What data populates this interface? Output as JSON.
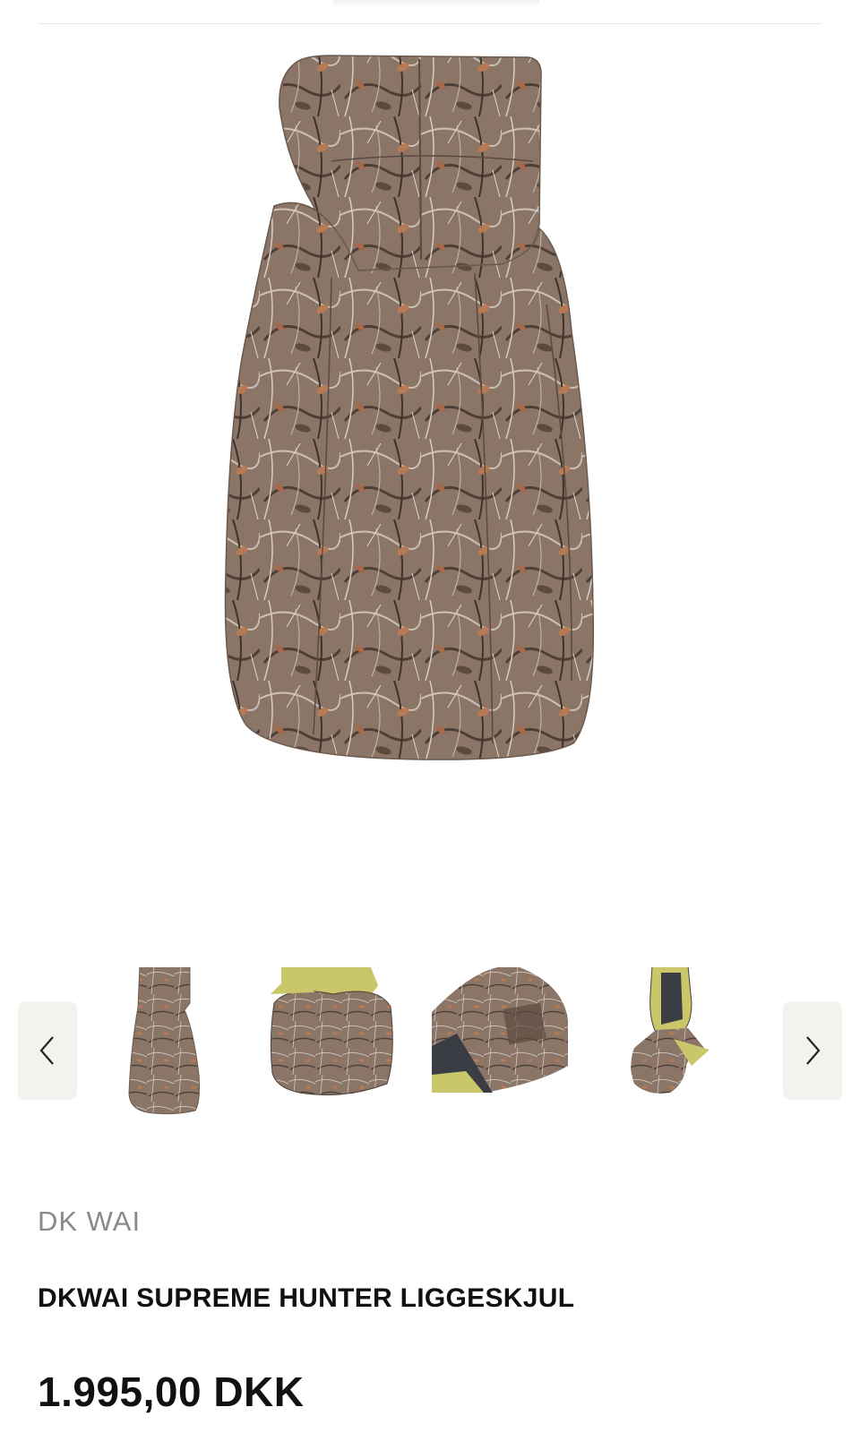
{
  "product": {
    "brand": "DK WAI",
    "title": "DKWAI SUPREME HUNTER LIGGESKJUL",
    "price": "1.995,00 DKK",
    "main_image_alt": "DKWAI SUPREME HUNTER LIGGESKJUL"
  },
  "gallery": {
    "prev_icon": "chevron-left-icon",
    "next_icon": "chevron-right-icon",
    "thumbnails": [
      {
        "alt": "DKWAI SUPREME HUNTER LIGGESKJUL"
      },
      {
        "alt": "DKWAI SUPREME HUNTER LIGGESKJUL"
      },
      {
        "alt": "DKWAI SUPREME HUNTER LIGGESKJUL"
      },
      {
        "alt": "DKWAI SUPREME HUNTER LIGGESKJUL"
      }
    ]
  },
  "colors": {
    "camo_base": "#8a7566",
    "camo_dark": "#4d3f36",
    "camo_light": "#cbbfb3",
    "camo_orange": "#b87a55",
    "lining_yellow": "#c9c76a",
    "nav_bg": "#f3f2ee",
    "brand_text": "#8a8a8a",
    "text": "#111111"
  }
}
